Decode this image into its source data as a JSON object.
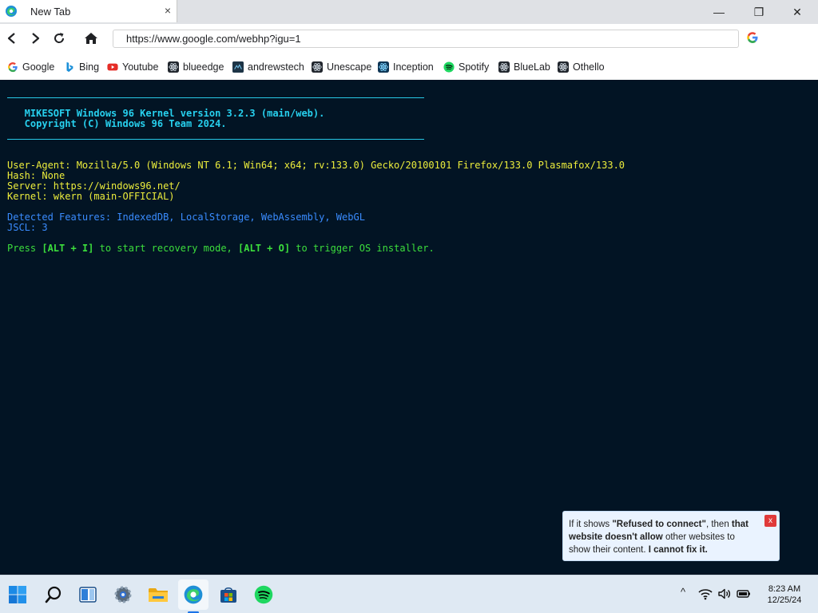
{
  "browser": {
    "tab": {
      "title": "New Tab",
      "close_label": "×"
    },
    "window": {
      "minimize": "—",
      "maximize": "❐",
      "close": "✕"
    },
    "address": {
      "url": "https://www.google.com/webhp?igu=1"
    }
  },
  "bookmarks": [
    {
      "label": "Google",
      "icon": "google-icon"
    },
    {
      "label": "Bing",
      "icon": "bing-icon"
    },
    {
      "label": "Youtube",
      "icon": "youtube-icon"
    },
    {
      "label": "blueedge",
      "icon": "react-icon"
    },
    {
      "label": "andrewstech",
      "icon": "andrewstech-icon"
    },
    {
      "label": "Unescape",
      "icon": "react-icon"
    },
    {
      "label": "Inception",
      "icon": "react-icon"
    },
    {
      "label": "Spotify",
      "icon": "spotify-icon"
    },
    {
      "label": "BlueLab",
      "icon": "react-icon"
    },
    {
      "label": "Othello",
      "icon": "react-icon"
    }
  ],
  "terminal": {
    "banner_line1": "   MIKESOFT Windows 96 Kernel version 3.2.3 (main/web).",
    "banner_line2": "   Copyright (C) Windows 96 Team 2024.",
    "user_agent": "User-Agent: Mozilla/5.0 (Windows NT 6.1; Win64; x64; rv:133.0) Gecko/20100101 Firefox/133.0 Plasmafox/133.0",
    "hash": "Hash: None",
    "server": "Server: https://windows96.net/",
    "kernel": "Kernel: wkern (main-OFFICIAL)",
    "features": "Detected Features: IndexedDB, LocalStorage, WebAssembly, WebGL",
    "jscl": "JSCL: 3",
    "prompt_pre": "Press ",
    "prompt_key1": "[ALT + I]",
    "prompt_mid": " to start recovery mode, ",
    "prompt_key2": "[ALT + O]",
    "prompt_post": " to trigger OS installer."
  },
  "notice": {
    "t1": "If it shows ",
    "b1": "\"Refused to connect\"",
    "t2": ", then ",
    "b2": "that website doesn't allow",
    "t3": " other websites to show their content. ",
    "b3": "I cannot fix it.",
    "close_label": "x"
  },
  "taskbar": {
    "time": "8:23 AM",
    "date": "12/25/24",
    "chevron": "^"
  },
  "colors": {
    "terminal_bg": "#021424",
    "cyan": "#27d0ee",
    "yellow": "#eded3c",
    "blue": "#3a8cff",
    "green": "#3cde3c"
  }
}
